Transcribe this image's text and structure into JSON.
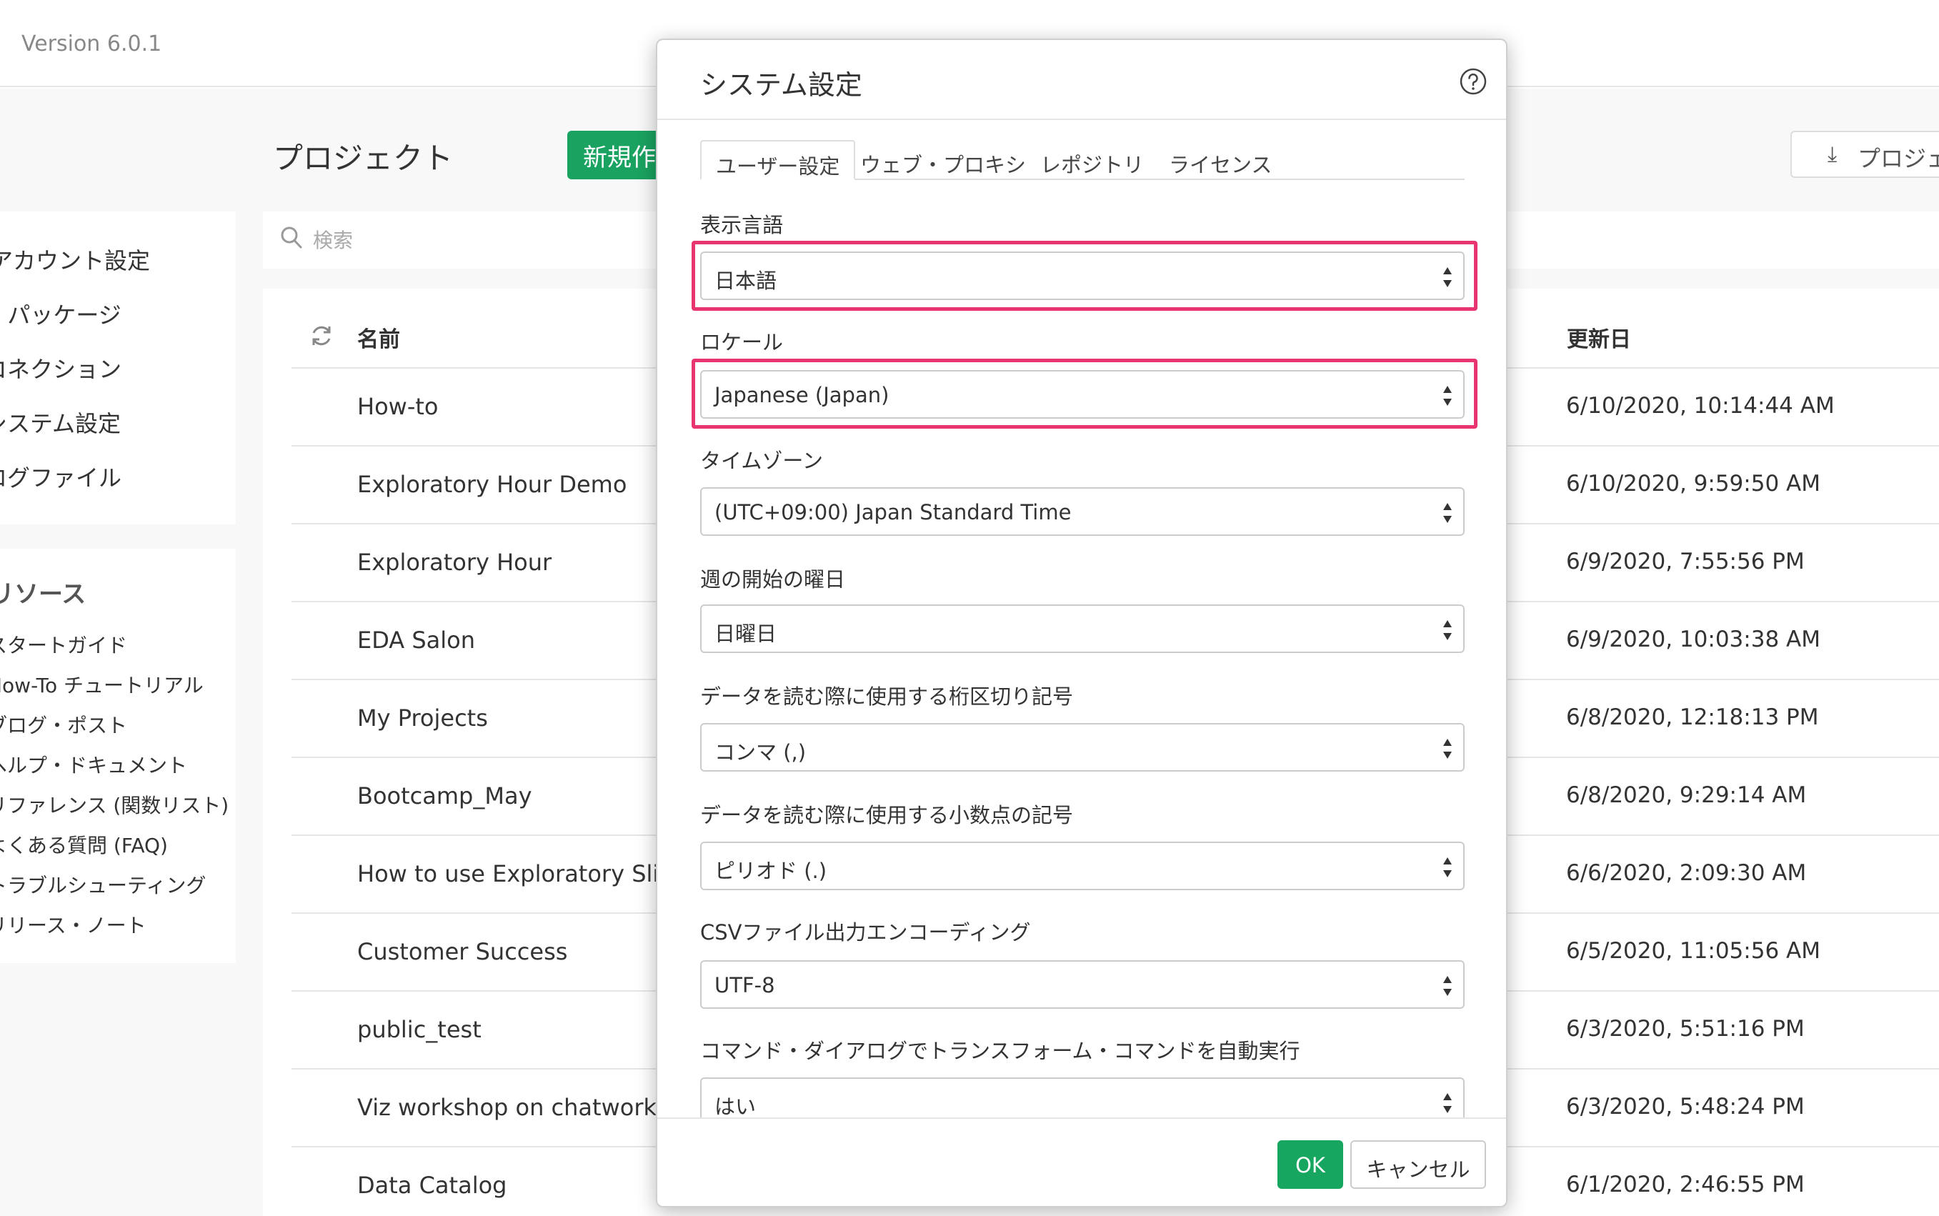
{
  "app": {
    "version": "Version 6.0.1"
  },
  "sidebar": {
    "menu": [
      "アカウント設定",
      "R パッケージ",
      "コネクション",
      "システム設定",
      "ログファイル"
    ],
    "resources_title": "リソース",
    "resources": [
      "スタートガイド",
      "How-To チュートリアル",
      "ブログ・ポスト",
      "ヘルプ・ドキュメント",
      "リファレンス (関数リスト)",
      "よくある質問 (FAQ)",
      "トラブルシューティング",
      "リリース・ノート"
    ]
  },
  "projects": {
    "title": "プロジェクト",
    "new_label": "新規作成",
    "export_label": "プロジェクト",
    "search_placeholder": "検索",
    "col_name": "名前",
    "col_updated": "更新日",
    "rows": [
      {
        "name": "How-to",
        "updated": "6/10/2020, 10:14:44 AM"
      },
      {
        "name": "Exploratory Hour Demo",
        "updated": "6/10/2020, 9:59:50 AM"
      },
      {
        "name": "Exploratory Hour",
        "updated": "6/9/2020, 7:55:56 PM"
      },
      {
        "name": "EDA Salon",
        "updated": "6/9/2020, 10:03:38 AM"
      },
      {
        "name": "My Projects",
        "updated": "6/8/2020, 12:18:13 PM"
      },
      {
        "name": "Bootcamp_May",
        "updated": "6/8/2020, 9:29:14 AM"
      },
      {
        "name": "How to use Exploratory Slides",
        "updated": "6/6/2020, 2:09:30 AM"
      },
      {
        "name": "Customer Success",
        "updated": "6/5/2020, 11:05:56 AM"
      },
      {
        "name": "public_test",
        "updated": "6/3/2020, 5:51:16 PM"
      },
      {
        "name": "Viz workshop on chatwork",
        "updated": "6/3/2020, 5:48:24 PM"
      },
      {
        "name": "Data Catalog",
        "updated": "6/1/2020, 2:46:55 PM"
      }
    ]
  },
  "modal": {
    "title": "システム設定",
    "tabs": [
      "ユーザー設定",
      "ウェブ・プロキシ",
      "レポジトリ",
      "ライセンス"
    ],
    "active_tab": 0,
    "fields": [
      {
        "label": "表示言語",
        "value": "日本語"
      },
      {
        "label": "ロケール",
        "value": "Japanese (Japan)"
      },
      {
        "label": "タイムゾーン",
        "value": "(UTC+09:00) Japan Standard Time"
      },
      {
        "label": "週の開始の曜日",
        "value": "日曜日"
      },
      {
        "label": "データを読む際に使用する桁区切り記号",
        "value": "コンマ (,)"
      },
      {
        "label": "データを読む際に使用する小数点の記号",
        "value": "ピリオド (.)"
      },
      {
        "label": "CSVファイル出力エンコーディング",
        "value": "UTF-8"
      },
      {
        "label": "コマンド・ダイアログでトランスフォーム・コマンドを自動実行",
        "value": "はい"
      }
    ],
    "ok_label": "OK",
    "cancel_label": "キャンセル"
  },
  "colors": {
    "accent_green": "#1aa260",
    "highlight_pink": "#e83570"
  }
}
